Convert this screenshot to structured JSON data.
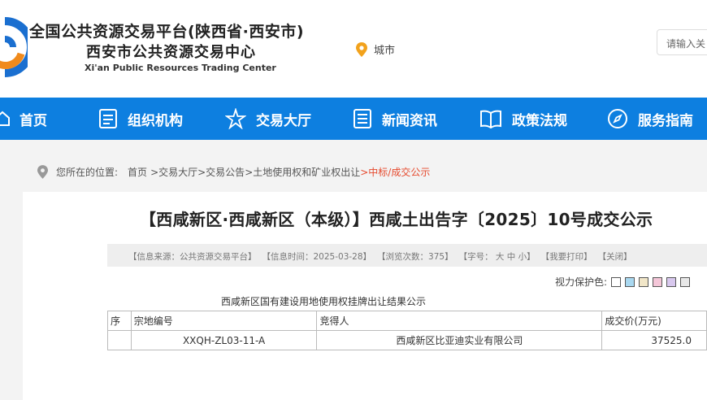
{
  "header": {
    "title": "全国公共资源交易平台(陕西省·西安市)",
    "subtitle": "西安市公共资源交易中心",
    "subtitle_en": "Xi'an Public Resources Trading Center",
    "city": "城市",
    "search_placeholder": "请输入关",
    "logo_colors": [
      "#f08a1c",
      "#1a6fd0"
    ]
  },
  "nav": {
    "items": [
      {
        "label": "首页",
        "icon": "home-icon"
      },
      {
        "label": "组织机构",
        "icon": "document-icon"
      },
      {
        "label": "交易大厅",
        "icon": "star-icon"
      },
      {
        "label": "新闻资讯",
        "icon": "news-icon"
      },
      {
        "label": "政策法规",
        "icon": "book-icon"
      },
      {
        "label": "服务指南",
        "icon": "compass-icon"
      }
    ]
  },
  "breadcrumb": {
    "label": "您所在的位置:",
    "items": [
      "首页",
      ">交易大厅",
      ">交易公告",
      ">土地使用权和矿业权出让",
      ">中标/成交公示"
    ]
  },
  "article": {
    "title": "【西咸新区·西咸新区（本级）】西咸土出告字〔2025〕10号成交公示",
    "info": {
      "source": "【信息来源：公共资源交易平台】",
      "time": "【信息时间：2025-03-28】",
      "views": "【浏览次数：375】",
      "font": "【字号： 大 中 小】",
      "print": "【我要打印】",
      "close": "【关闭】"
    },
    "eye_protect_label": "视力保护色:",
    "eye_protect_colors": [
      "#ffffff",
      "#a9d8f0",
      "#f1e6c8",
      "#f4c6d8",
      "#d8c8ee",
      "#e8e8e8"
    ],
    "table_caption": "西咸新区国有建设用地使用权挂牌出让结果公示",
    "table": {
      "headers": [
        "序",
        "宗地编号",
        "竞得人",
        "成交价(万元)"
      ],
      "rows": [
        [
          "",
          "XXQH-ZL03-11-A",
          "西咸新区比亚迪实业有限公司",
          "37525.0"
        ]
      ]
    }
  }
}
